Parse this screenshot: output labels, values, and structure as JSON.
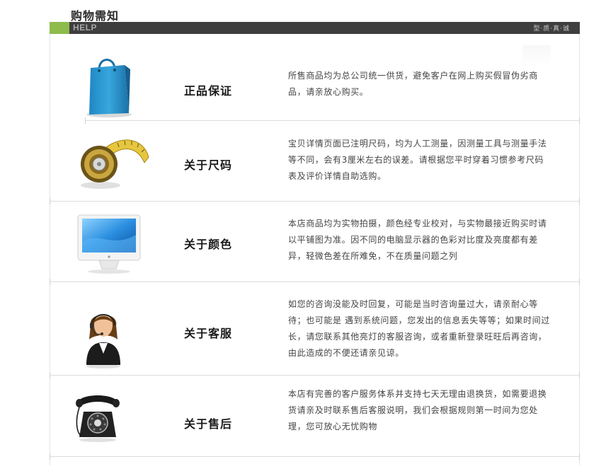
{
  "header": {
    "title": "购物需知",
    "help_label": "HELP",
    "slogan": "型·质·真·诚"
  },
  "sections": [
    {
      "heading": "正品保证",
      "icon": "shopping-bag-icon",
      "text": "所售商品均为总公司统一供货，避免客户在网上购买假冒伪劣商品，请亲放心购买。"
    },
    {
      "heading": "关于尺码",
      "icon": "tape-measure-icon",
      "text": "宝贝详情页面已注明尺码，均为人工测量，因测量工具与测量手法等不同，会有3厘米左右的误差。请根据您平时穿着习惯参考尺码表及评价详情自助选购。"
    },
    {
      "heading": "关于颜色",
      "icon": "monitor-icon",
      "text": "本店商品均为实物拍摄，颜色经专业校对，与实物最接近购买时请以平铺图为准。因不同的电脑显示器的色彩对比度及亮度都有差异，轻微色差在所难免，不在质量问题之列"
    },
    {
      "heading": "关于客服",
      "icon": "customer-service-icon",
      "text": "如您的咨询没能及时回复，可能是当时咨询量过大，请亲耐心等待；也可能是 遇到系统问题，您发出的信息丢失等等；如果时间过长，请您联系其他亮灯的客服咨询，或者重新登录旺旺后再咨询，由此造成的不便还请亲见谅。"
    },
    {
      "heading": "关于售后",
      "icon": "telephone-icon",
      "text": "本店有完善的客户服务体系并支持七天无理由退换货，如需要退换货请亲及时联系售后客服说明，我们会根据规则第一时间为您处理，您可放心无忧购物"
    }
  ]
}
